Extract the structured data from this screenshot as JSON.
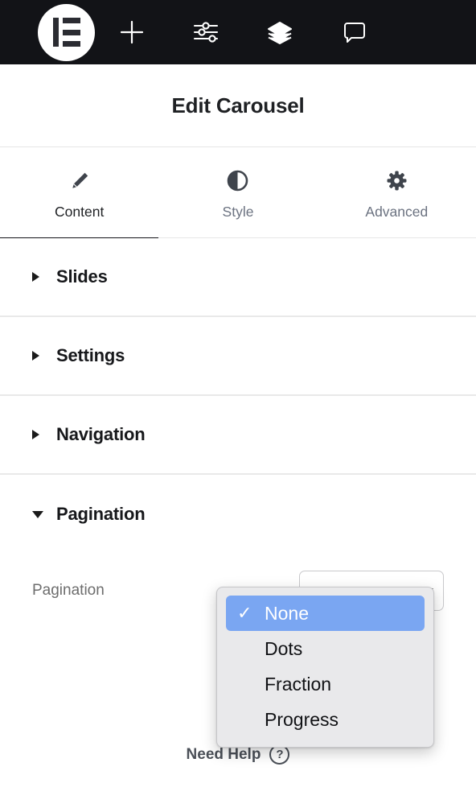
{
  "topbar": {
    "logo": {
      "name": "elementor-logo",
      "label": "Elementor"
    },
    "buttons": [
      {
        "name": "add-element-button",
        "icon": "plus-icon",
        "label": "Add Element"
      },
      {
        "name": "page-settings-button",
        "icon": "sliders-icon",
        "label": "Page Settings"
      },
      {
        "name": "navigator-button",
        "icon": "layers-icon",
        "label": "Navigator"
      },
      {
        "name": "notes-button",
        "icon": "comment-icon",
        "label": "Notes"
      }
    ]
  },
  "panel": {
    "title": "Edit Carousel"
  },
  "tabs": [
    {
      "label": "Content",
      "icon": "pencil-icon",
      "active": true
    },
    {
      "label": "Style",
      "icon": "contrast-icon",
      "active": false
    },
    {
      "label": "Advanced",
      "icon": "gear-icon",
      "active": false
    }
  ],
  "sections": [
    {
      "label": "Slides",
      "expanded": false
    },
    {
      "label": "Settings",
      "expanded": false
    },
    {
      "label": "Navigation",
      "expanded": false
    },
    {
      "label": "Pagination",
      "expanded": true
    }
  ],
  "pagination_control": {
    "label": "Pagination",
    "selected_value": "None"
  },
  "dropdown": {
    "open": true,
    "checkmark": "✓",
    "options": [
      {
        "label": "None",
        "selected": true
      },
      {
        "label": "Dots",
        "selected": false
      },
      {
        "label": "Fraction",
        "selected": false
      },
      {
        "label": "Progress",
        "selected": false
      }
    ]
  },
  "footer": {
    "need_help_label": "Need Help",
    "help_icon_glyph": "?"
  },
  "colors": {
    "topbar_bg": "#121317",
    "accent_selected": "#7aa6f2",
    "tab_active_underline": "#121317",
    "divider": "#e9e9e9",
    "dropdown_bg": "#e9e9eb"
  }
}
